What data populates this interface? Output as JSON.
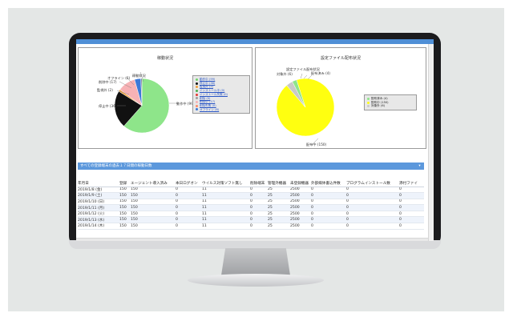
{
  "left_chart": {
    "title": "稼動状況",
    "chart_data": {
      "type": "pie",
      "title": "稼動状況",
      "slices": [
        {
          "label": "動作中",
          "value": 99,
          "color": "#8ee58a"
        },
        {
          "label": "停止中",
          "value": 36,
          "color": "#111111"
        },
        {
          "label": "監視外",
          "value": 2,
          "color": "#f4a13a"
        },
        {
          "label": "削除中",
          "value": 17,
          "color": "#f7b2b5"
        },
        {
          "label": "オフライン",
          "value": 6,
          "color": "#3b78d8"
        },
        {
          "label": "稼動状況",
          "value": 1,
          "color": "#5f5f8c"
        }
      ]
    },
    "pie_labels": {
      "running": "動作中 (99)",
      "stopped": "停止中 (36)",
      "monitor_out": "監視外 (2)",
      "deleting": "削除中 (17)",
      "offline": "オフライン (6)",
      "status": "稼動状況"
    },
    "legend": [
      {
        "label": "動作中 (99)",
        "color": "#6fd46b"
      },
      {
        "label": "停止中 (36)",
        "color": "#111111"
      },
      {
        "label": "監視外 (2)",
        "color": "#f4a13a"
      },
      {
        "label": "インストール中 (0)",
        "color": "#4caf50"
      },
      {
        "label": "インストール失敗 (0)",
        "color": "#e53935"
      },
      {
        "label": "削除 (0)",
        "color": "#9e9e9e"
      },
      {
        "label": "削除中 (17)",
        "color": "#f7b2b5"
      },
      {
        "label": "削除失敗 (0)",
        "color": "#ff8a65"
      },
      {
        "label": "オフライン (6)",
        "color": "#3b78d8"
      }
    ]
  },
  "right_chart": {
    "title": "設定ファイル配布状況",
    "chart_data": {
      "type": "pie",
      "title": "設定ファイル配布状況",
      "slices": [
        {
          "label": "配布中",
          "value": 150,
          "color": "#ffff10"
        },
        {
          "label": "対象外",
          "value": 6,
          "color": "#c9c9c9"
        },
        {
          "label": "配布済み",
          "value": 4,
          "color": "#8ee58a"
        }
      ]
    },
    "pie_labels": {
      "in_progress": "配布中 (150)",
      "excluded": "対象外 (6)",
      "distributed": "配布済み (4)",
      "status": "設定ファイル配布状況"
    },
    "legend": [
      {
        "label": "配布済み (4)",
        "color": "#8ee58a"
      },
      {
        "label": "配布中 (150)",
        "color": "#ffff10"
      },
      {
        "label": "対象外 (6)",
        "color": "#c9c9c9"
      }
    ]
  },
  "section": {
    "title": "すべての登録端末の過去１７日間の稼動日数",
    "toggle": "▾"
  },
  "table": {
    "headers": [
      "年月日",
      "登録",
      "エージェント導入済み",
      "本日ログオン",
      "ウイルス対策ソフト無し",
      "削除端末",
      "管理外機器",
      "未登録機器",
      "外部媒体書込件数",
      "プログラムインストール数",
      "添付ファイ"
    ],
    "rows": [
      [
        "2019/1/8 (金)",
        "150",
        "150",
        "0",
        "11",
        "0",
        "25",
        "2500",
        "0",
        "0",
        "0"
      ],
      [
        "2019/1/9 (土)",
        "150",
        "150",
        "0",
        "11",
        "0",
        "25",
        "2500",
        "0",
        "0",
        "0"
      ],
      [
        "2019/1/10 (日)",
        "150",
        "150",
        "0",
        "11",
        "0",
        "25",
        "2500",
        "0",
        "0",
        "0"
      ],
      [
        "2019/1/11 (月)",
        "150",
        "150",
        "0",
        "11",
        "0",
        "25",
        "2500",
        "0",
        "0",
        "0"
      ],
      [
        "2019/1/12 (火)",
        "150",
        "150",
        "0",
        "11",
        "0",
        "25",
        "2500",
        "0",
        "0",
        "0"
      ],
      [
        "2019/1/13 (水)",
        "150",
        "150",
        "0",
        "11",
        "0",
        "25",
        "2500",
        "0",
        "0",
        "0"
      ],
      [
        "2019/1/14 (木)",
        "150",
        "150",
        "0",
        "11",
        "0",
        "25",
        "2500",
        "0",
        "0",
        "0"
      ]
    ]
  }
}
